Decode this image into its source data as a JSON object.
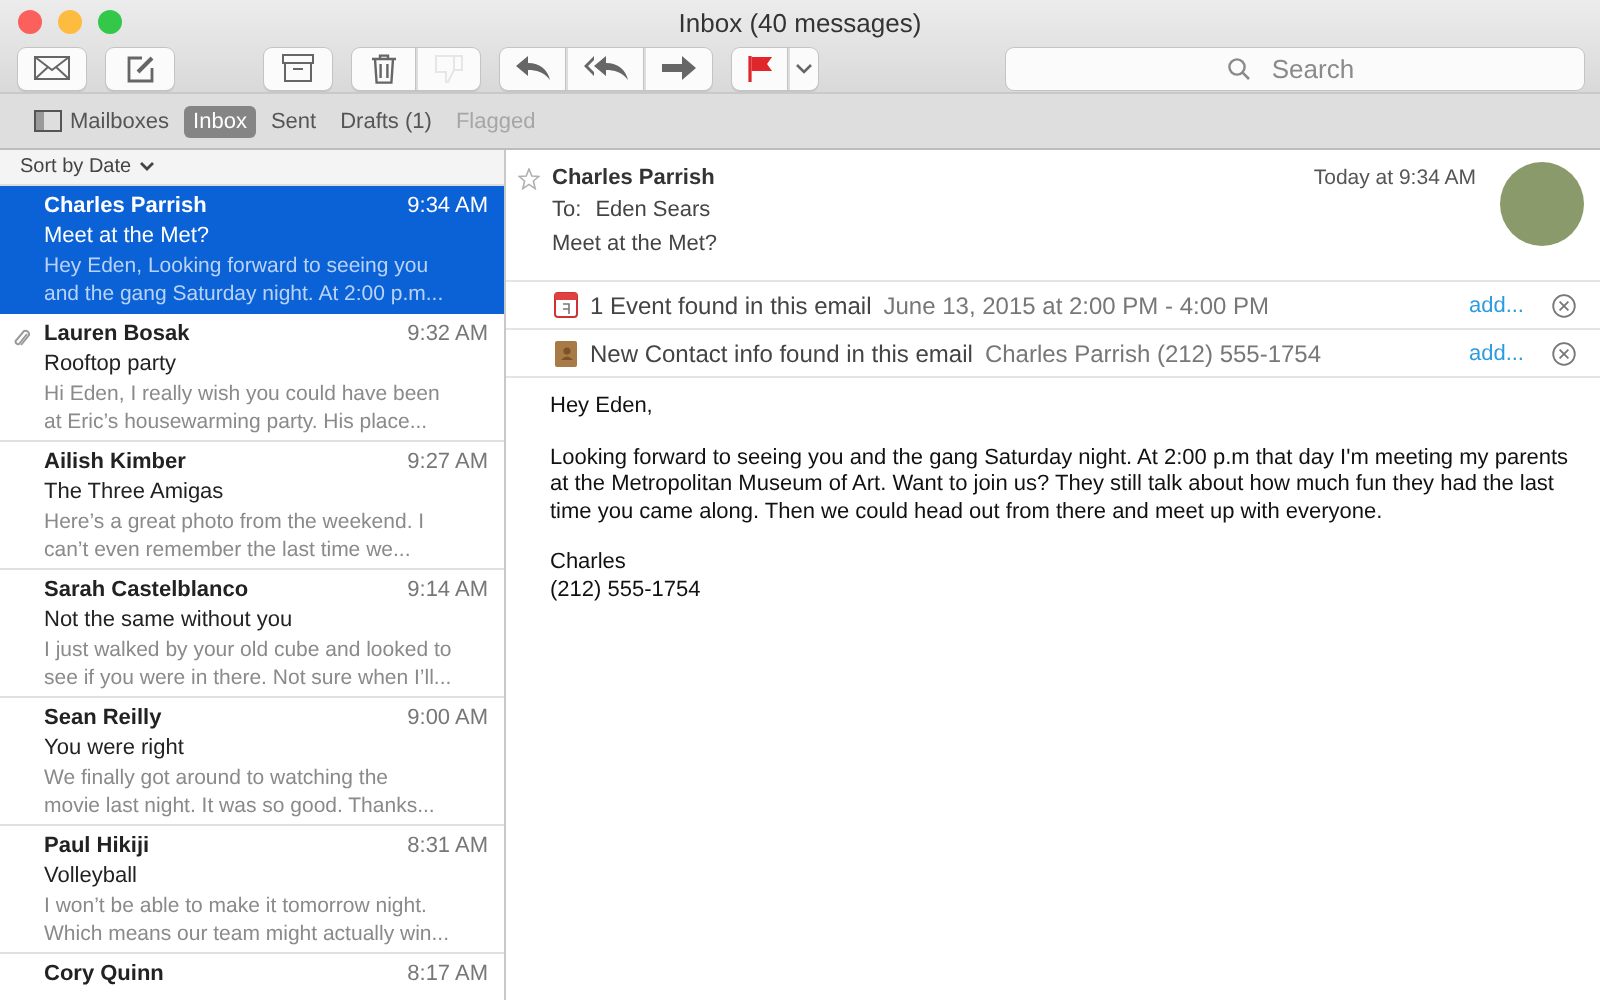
{
  "window": {
    "title": "Inbox (40 messages)"
  },
  "toolbar": {
    "groups": [
      [
        {
          "kind": "get-mail",
          "disabled": false
        }
      ],
      [
        {
          "kind": "compose",
          "disabled": false
        }
      ],
      [
        {
          "kind": "archive",
          "disabled": false
        }
      ],
      [
        {
          "kind": "delete",
          "disabled": false
        },
        {
          "kind": "junk",
          "disabled": true
        }
      ],
      [
        {
          "kind": "reply",
          "disabled": false
        },
        {
          "kind": "reply-all",
          "disabled": false
        },
        {
          "kind": "forward",
          "disabled": false
        }
      ],
      [
        {
          "kind": "flag",
          "disabled": false
        },
        {
          "kind": "menu",
          "disabled": false
        }
      ]
    ],
    "search": {
      "placeholder": "Search"
    }
  },
  "favorites": [
    {
      "label": "Mailboxes",
      "kind": "sidebar",
      "selected": false,
      "disabled": false
    },
    {
      "label": "Inbox",
      "kind": "plain",
      "selected": true,
      "disabled": false
    },
    {
      "label": "Sent",
      "kind": "plain",
      "selected": false,
      "disabled": false
    },
    {
      "label": "Drafts (1)",
      "kind": "plain",
      "selected": false,
      "disabled": false
    },
    {
      "label": "Flagged",
      "kind": "plain",
      "selected": false,
      "disabled": true
    }
  ],
  "sort": {
    "label": "Sort by Date"
  },
  "messages": [
    {
      "sender": "Charles Parrish",
      "time": "9:34 AM",
      "subject": "Meet at the Met?",
      "preview": [
        "Hey Eden, Looking forward to seeing you",
        "and the gang Saturday night. At 2:00 p.m..."
      ],
      "selected": true,
      "attachment": false
    },
    {
      "sender": "Lauren Bosak",
      "time": "9:32 AM",
      "subject": "Rooftop party",
      "preview": [
        "Hi Eden, I really wish you could have been",
        "at Eric’s housewarming party. His place..."
      ],
      "selected": false,
      "attachment": true
    },
    {
      "sender": "Ailish Kimber",
      "time": "9:27 AM",
      "subject": "The Three Amigas",
      "preview": [
        "Here’s a great photo from the weekend. I",
        "can’t even remember the last time we..."
      ],
      "selected": false,
      "attachment": false
    },
    {
      "sender": "Sarah Castelblanco",
      "time": "9:14 AM",
      "subject": "Not the same without you",
      "preview": [
        "I just walked by your old cube and looked to",
        "see if you were in there. Not sure when I’ll..."
      ],
      "selected": false,
      "attachment": false
    },
    {
      "sender": "Sean Reilly",
      "time": "9:00 AM",
      "subject": "You were right",
      "preview": [
        "We finally got around to watching the",
        "movie last night. It was so good. Thanks..."
      ],
      "selected": false,
      "attachment": false
    },
    {
      "sender": "Paul Hikiji",
      "time": "8:31 AM",
      "subject": "Volleyball",
      "preview": [
        "I won’t be able to make it tomorrow night.",
        "Which means our team might actually win..."
      ],
      "selected": false,
      "attachment": false
    },
    {
      "sender": "Cory Quinn",
      "time": "8:17 AM",
      "selected": false,
      "attachment": false
    }
  ],
  "reader": {
    "sender": "Charles Parrish",
    "flagged": false,
    "to_label": "To:",
    "to": "Eden Sears",
    "subject": "Meet at the Met?",
    "date": "Today at 9:34 AM",
    "suggestions": [
      {
        "kind": "event",
        "title": "1 Event found in this email",
        "detail": "June 13, 2015 at 2:00 PM - 4:00 PM",
        "action": "add..."
      },
      {
        "kind": "contact",
        "title": "New Contact info found in this email",
        "detail": "Charles Parrish (212) 555-1754",
        "action": "add..."
      }
    ],
    "body": [
      [
        "Hey Eden,"
      ],
      [
        "Looking forward to seeing you and the gang Saturday night. At 2:00 p.m that day I'm meeting my parents at the Metropolitan Museum of Art. Want to join us? They still talk about how much fun they had the last time you came along. Then we could head out from there and meet up with everyone."
      ],
      [
        "Charles",
        "(212) 555-1754"
      ]
    ]
  }
}
